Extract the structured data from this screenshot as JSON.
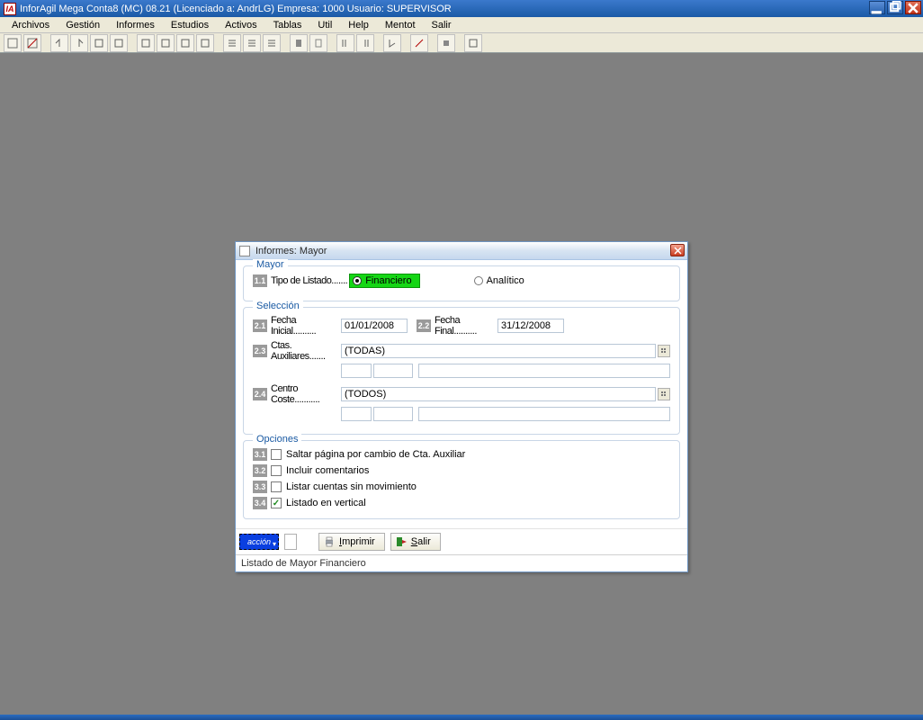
{
  "app": {
    "title": "InforAgil Mega Conta8 (MC) 08.21  (Licenciado a: AndrLG)  Empresa: 1000  Usuario: SUPERVISOR"
  },
  "menu": {
    "items": [
      "Archivos",
      "Gestión",
      "Informes",
      "Estudios",
      "Activos",
      "Tablas",
      "Util",
      "Help",
      "Mentot",
      "Salir"
    ]
  },
  "dialog": {
    "title": "Informes: Mayor",
    "groups": {
      "mayor": {
        "legend": "Mayor",
        "tipo_listado_tag": "1.1",
        "tipo_listado_label": "Tipo de Listado.......",
        "radio_financiero": "Financiero",
        "radio_analitico": "Analítico"
      },
      "seleccion": {
        "legend": "Selección",
        "fecha_inicial_tag": "2.1",
        "fecha_inicial_label": "Fecha Inicial..........",
        "fecha_inicial_value": "01/01/2008",
        "fecha_final_tag": "2.2",
        "fecha_final_label": "Fecha Final..........",
        "fecha_final_value": "31/12/2008",
        "ctas_aux_tag": "2.3",
        "ctas_aux_label": "Ctas. Auxiliares.......",
        "ctas_aux_value": "(TODAS)",
        "centro_coste_tag": "2.4",
        "centro_coste_label": "Centro Coste...........",
        "centro_coste_value": "(TODOS)"
      },
      "opciones": {
        "legend": "Opciones",
        "o1_tag": "3.1",
        "o1_label": "Saltar página por cambio de Cta. Auxiliar",
        "o2_tag": "3.2",
        "o2_label": "Incluir comentarios",
        "o3_tag": "3.3",
        "o3_label": "Listar cuentas sin movimiento",
        "o4_tag": "3.4",
        "o4_label": "Listado en vertical",
        "o4_checked": true
      }
    },
    "buttons": {
      "accion": "acción",
      "imprimir": "Imprimir",
      "salir": "Salir"
    },
    "status": "Listado de Mayor Financiero"
  }
}
